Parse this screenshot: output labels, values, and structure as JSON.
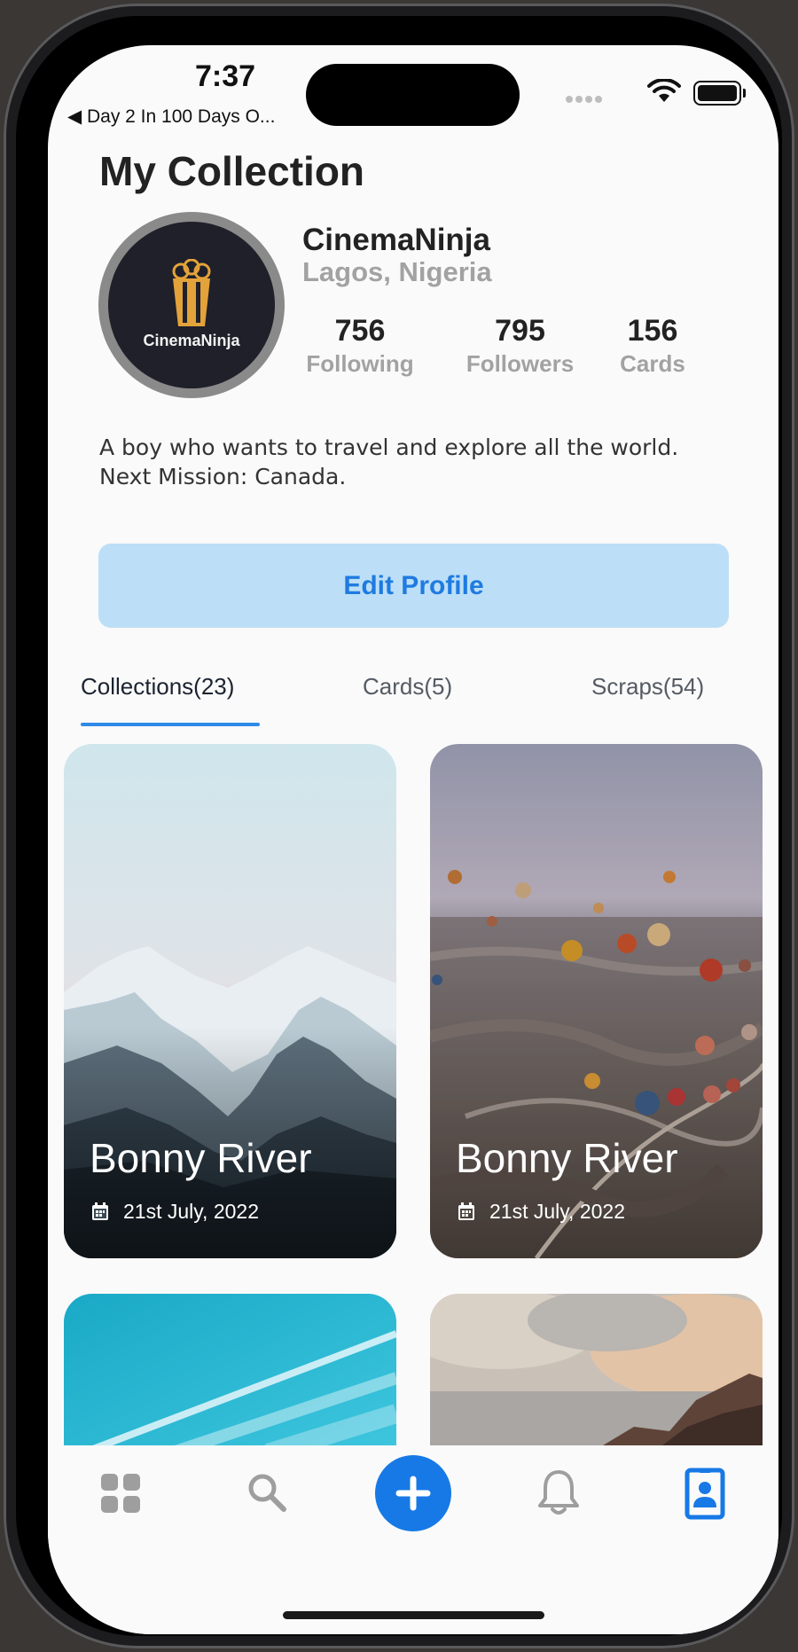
{
  "status_bar": {
    "time": "7:37",
    "back_app": "◀ Day 2 In 100 Days O..."
  },
  "header": {
    "title": "My Collection"
  },
  "profile": {
    "avatar_text": "CinemaNinja",
    "name": "CinemaNinja",
    "location": "Lagos, Nigeria",
    "stats": [
      {
        "value": "756",
        "label": "Following"
      },
      {
        "value": "795",
        "label": "Followers"
      },
      {
        "value": "156",
        "label": "Cards"
      }
    ],
    "bio_line1": "A boy who wants to travel and explore all the world.",
    "bio_line2": "Next Mission: Canada.",
    "edit_button": "Edit Profile"
  },
  "tabs": [
    {
      "label": "Collections(23)",
      "active": true
    },
    {
      "label": "Cards(5)",
      "active": false
    },
    {
      "label": "Scraps(54)",
      "active": false
    }
  ],
  "collections": [
    {
      "title": "Bonny River",
      "date": "21st July, 2022",
      "image": "snowy-mountains"
    },
    {
      "title": "Bonny River",
      "date": "21st July, 2022",
      "image": "hot-air-balloons"
    },
    {
      "image": "blue-sky"
    },
    {
      "image": "cloudy-cliff"
    }
  ],
  "bottom_nav": [
    {
      "icon": "grid-icon",
      "active": false
    },
    {
      "icon": "search-icon",
      "active": false
    },
    {
      "icon": "add-icon",
      "active": false
    },
    {
      "icon": "bell-icon",
      "active": false
    },
    {
      "icon": "profile-card-icon",
      "active": true
    }
  ],
  "colors": {
    "accent": "#1779e6",
    "edit_button_bg": "#bcdff7",
    "tab_underline": "#2e8ae6",
    "muted_text": "#a2a2a2"
  }
}
